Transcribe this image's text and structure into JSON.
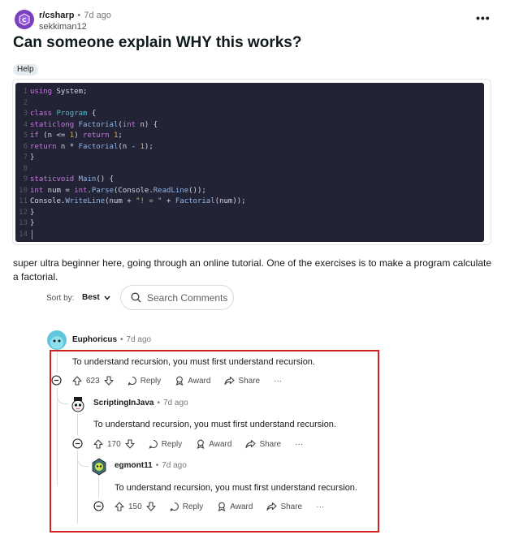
{
  "post": {
    "subreddit": "r/csharp",
    "time": "7d ago",
    "author": "sekkiman12",
    "title": "Can someone explain WHY this works?",
    "flair": "Help",
    "body": "super ultra beginner here, going through an online tutorial. One of the exercises is to make a program calculate a factorial.",
    "more_label": "•••"
  },
  "code": {
    "line_numbers": [
      "1",
      "2",
      "3",
      "4",
      "5",
      "6",
      "7",
      "8",
      "9",
      "10",
      "11",
      "12",
      "13",
      "14"
    ]
  },
  "sort": {
    "label": "Sort by:",
    "value": "Best"
  },
  "search": {
    "placeholder": "Search Comments"
  },
  "comments": [
    {
      "user": "Euphoricus",
      "time": "7d ago",
      "text": "To understand recursion, you must first understand recursion.",
      "votes": "623"
    },
    {
      "user": "ScriptingInJava",
      "time": "7d ago",
      "text": "To understand recursion, you must first understand recursion.",
      "votes": "170"
    },
    {
      "user": "egmont11",
      "time": "7d ago",
      "text": "To understand recursion, you must first understand recursion.",
      "votes": "150"
    }
  ],
  "actions": {
    "reply": "Reply",
    "award": "Award",
    "share": "Share",
    "more": "···"
  },
  "dot": "•",
  "colors": {
    "highlight": "#d22121",
    "code_bg": "#232336",
    "subreddit_icon": "#7b3fbf"
  }
}
